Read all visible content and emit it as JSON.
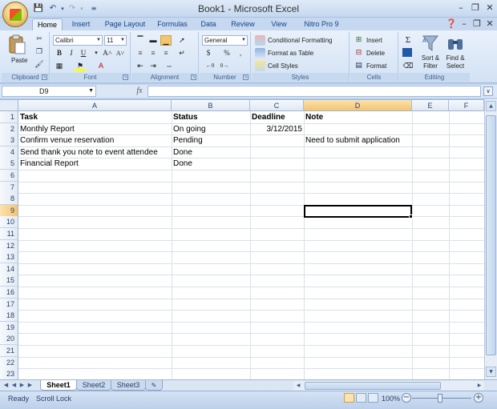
{
  "window": {
    "title": "Book1 - Microsoft Excel",
    "controls": [
      "minimize",
      "restore",
      "close"
    ]
  },
  "quick_access": [
    "save-icon",
    "undo-icon",
    "redo-icon",
    "customize-icon"
  ],
  "tabs": [
    {
      "label": "Home",
      "active": true
    },
    {
      "label": "Insert"
    },
    {
      "label": "Page Layout"
    },
    {
      "label": "Formulas"
    },
    {
      "label": "Data"
    },
    {
      "label": "Review"
    },
    {
      "label": "View"
    },
    {
      "label": "Nitro Pro 9"
    }
  ],
  "ribbon": {
    "clipboard": {
      "label": "Clipboard",
      "paste": "Paste"
    },
    "font": {
      "label": "Font",
      "family": "Calibri",
      "size": "11"
    },
    "alignment": {
      "label": "Alignment"
    },
    "number": {
      "label": "Number",
      "format": "General",
      "currency": "$",
      "percent": "%",
      "comma": ","
    },
    "styles": {
      "label": "Styles",
      "conditional": "Conditional Formatting",
      "format_table": "Format as Table",
      "cell_styles": "Cell Styles"
    },
    "cells": {
      "label": "Cells",
      "insert": "Insert",
      "delete": "Delete",
      "format": "Format"
    },
    "editing": {
      "label": "Editing",
      "sort": "Sort &",
      "sort2": "Filter",
      "find": "Find &",
      "find2": "Select"
    }
  },
  "formula_bar": {
    "name_box": "D9",
    "fx": "fx",
    "formula": ""
  },
  "columns": [
    "A",
    "B",
    "C",
    "D",
    "E",
    "F"
  ],
  "selected_column": "D",
  "selected_row": 9,
  "rows": [
    "1",
    "2",
    "3",
    "4",
    "5",
    "6",
    "7",
    "8",
    "9",
    "10",
    "11",
    "12",
    "13",
    "14",
    "15",
    "16",
    "17",
    "18",
    "19",
    "20",
    "21",
    "22",
    "23"
  ],
  "cells": {
    "A1": "Task",
    "B1": "Status",
    "C1": "Deadline",
    "D1": "Note",
    "A2": "Monthly Report",
    "B2": "On going",
    "C2": "3/12/2015",
    "A3": "Confirm venue reservation",
    "B3": "Pending",
    "D3": "Need to submit application",
    "A4": "Send thank you note to event attendee",
    "B4": "Done",
    "A5": "Financial Report",
    "B5": "Done"
  },
  "sheets": [
    {
      "label": "Sheet1",
      "active": true
    },
    {
      "label": "Sheet2"
    },
    {
      "label": "Sheet3"
    }
  ],
  "status": {
    "mode": "Ready",
    "scroll_lock": "Scroll Lock",
    "zoom": "100%"
  }
}
